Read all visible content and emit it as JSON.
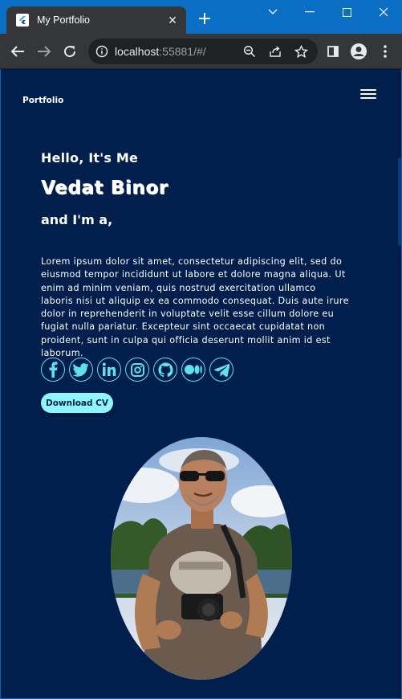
{
  "browser": {
    "tab_title": "My Portfolio",
    "url_host": "localhost",
    "url_rest": ":55881/#/"
  },
  "site": {
    "brand": "Portfolio",
    "hello": "Hello, It's Me",
    "name": "Vedat Binor",
    "role": "and I'm a,",
    "bio": "Lorem ipsum dolor sit amet, consectetur adipiscing elit, sed do eiusmod tempor incididunt ut labore et dolore magna aliqua. Ut enim ad minim veniam, quis nostrud exercitation ullamco laboris nisi ut aliquip ex ea commodo consequat. Duis aute irure dolor in reprehenderit in voluptate velit esse cillum dolore eu fugiat nulla pariatur. Excepteur sint occaecat cupidatat non proident, sunt in culpa qui officia deserunt mollit anim id est laborum.",
    "cv_button": "Download CV",
    "socials": [
      "facebook-icon",
      "twitter-icon",
      "linkedin-icon",
      "instagram-icon",
      "github-icon",
      "medium-icon",
      "telegram-icon"
    ]
  },
  "colors": {
    "page_bg": "#001f4d",
    "accent": "#5ee0f0",
    "button_bg": "#8ef6ff",
    "chrome_frame": "#0a6fc4",
    "chrome_toolbar": "#35363a"
  }
}
